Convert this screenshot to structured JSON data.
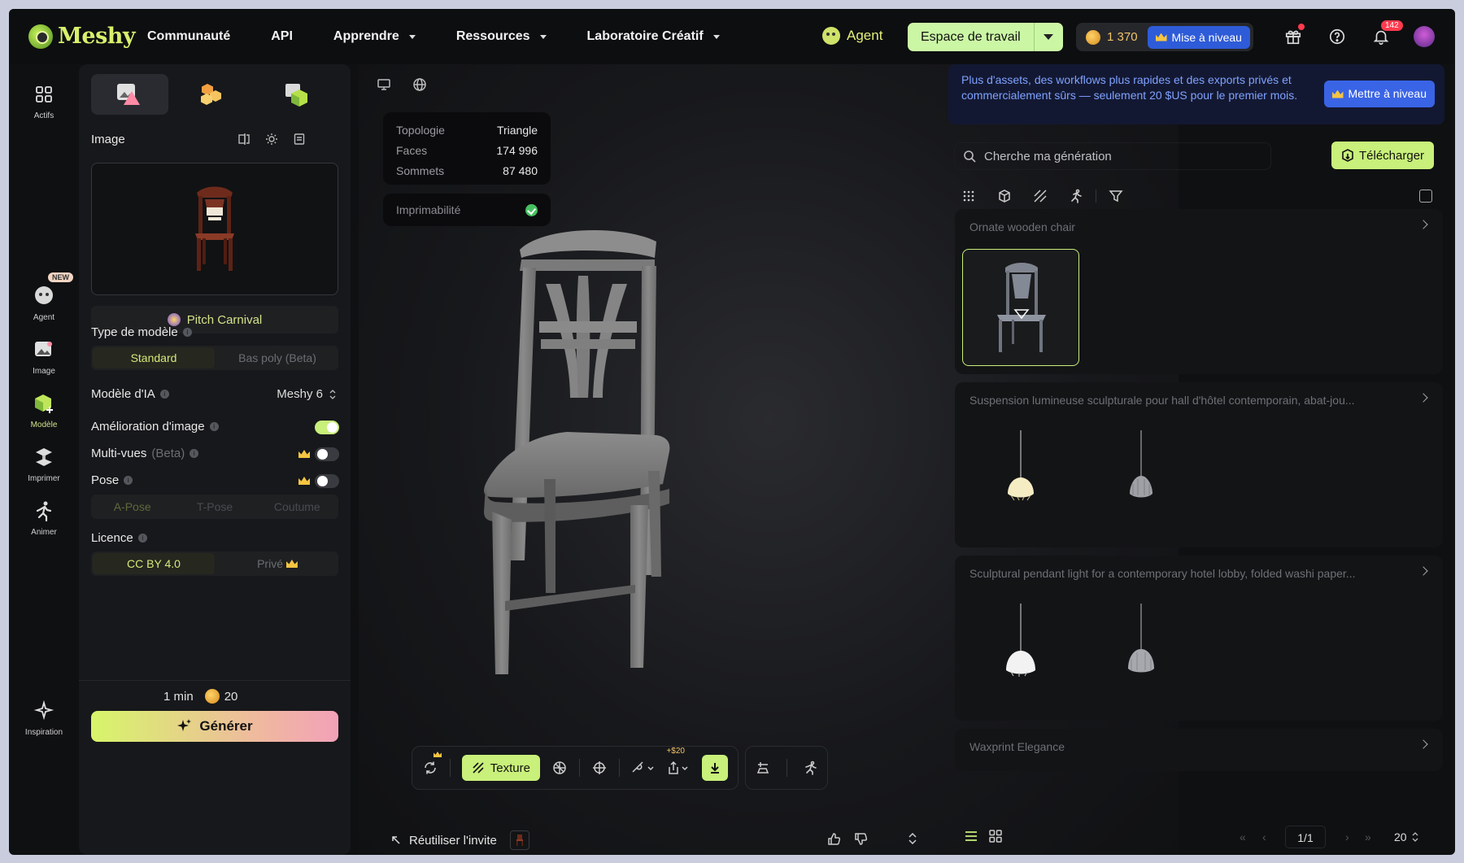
{
  "app": {
    "brand": "Meshy"
  },
  "nav": {
    "items": [
      {
        "label": "Communauté",
        "dropdown": false
      },
      {
        "label": "API",
        "dropdown": false
      },
      {
        "label": "Apprendre",
        "dropdown": true
      },
      {
        "label": "Ressources",
        "dropdown": true
      },
      {
        "label": "Laboratoire Créatif",
        "dropdown": true
      }
    ],
    "agent": "Agent",
    "workspace": "Espace de travail",
    "credits": "1 370",
    "upgrade": "Mise à niveau",
    "notifications": "142"
  },
  "rail": {
    "items": [
      {
        "label": "Actifs"
      },
      {
        "label": "Agent",
        "tag": "NEW"
      },
      {
        "label": "Image"
      },
      {
        "label": "Modèle"
      },
      {
        "label": "Imprimer"
      },
      {
        "label": "Animer"
      },
      {
        "label": "Inspiration"
      }
    ]
  },
  "panel": {
    "image_label": "Image",
    "style": "Pitch Carnival",
    "model_type_label": "Type de modèle",
    "model_type_options": [
      "Standard",
      "Bas poly (Beta)"
    ],
    "ai_model_label": "Modèle d'IA",
    "ai_model_value": "Meshy 6",
    "enhance_label": "Amélioration d'image",
    "multiview_label": "Multi-vues",
    "multiview_beta": "(Beta)",
    "pose_label": "Pose",
    "pose_options": [
      "A-Pose",
      "T-Pose",
      "Coutume"
    ],
    "license_label": "Licence",
    "license_options": [
      "CC BY 4.0",
      "Privé"
    ],
    "eta": "1 min",
    "cost": "20",
    "generate": "Générer"
  },
  "viewport": {
    "stats": [
      {
        "label": "Topologie",
        "value": "Triangle"
      },
      {
        "label": "Faces",
        "value": "174 996"
      },
      {
        "label": "Sommets",
        "value": "87 480"
      }
    ],
    "printable": "Imprimabilité",
    "texture": "Texture",
    "export_price": "+$20",
    "reuse": "Réutiliser l'invite"
  },
  "right": {
    "promo": "Plus d'assets, des workflows plus rapides et des exports privés et commercialement sûrs — seulement 20 $US pour le premier mois.",
    "promo_button": "Mettre à niveau",
    "search_placeholder": "Cherche ma génération",
    "download": "Télécharger",
    "cards": [
      {
        "title": "Ornate wooden chair"
      },
      {
        "title": "Suspension lumineuse sculpturale pour hall d'hôtel contemporain, abat-jou..."
      },
      {
        "title": "Sculptural pendant light for a contemporary hotel lobby, folded washi paper..."
      },
      {
        "title": "Waxprint Elegance"
      }
    ],
    "page": "1/1",
    "per_page": "20"
  },
  "colors": {
    "accent": "#c8f07a",
    "upgrade": "#2e5bd8",
    "bg": "#0f1012"
  }
}
